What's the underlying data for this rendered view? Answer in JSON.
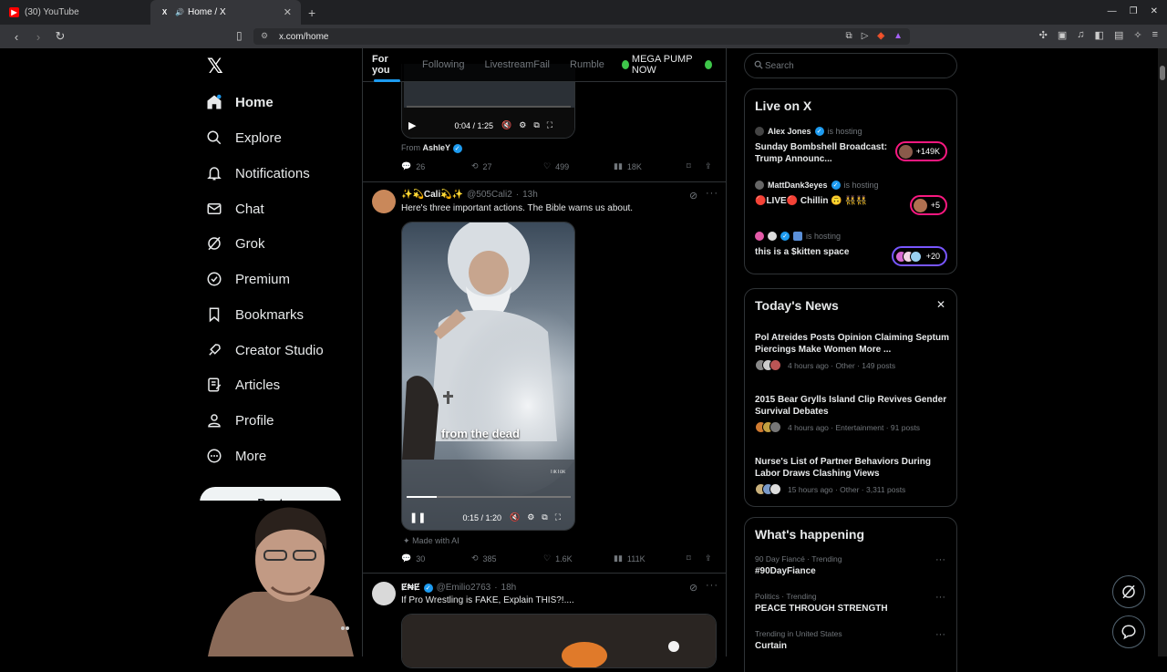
{
  "browser": {
    "tabs": [
      {
        "title": "(30) YouTube",
        "favicon_color": "#ff0000"
      },
      {
        "title": "Home / X",
        "favicon_color": "#ffffff"
      }
    ],
    "url": "x.com/home"
  },
  "nav": {
    "items": [
      {
        "label": "Home",
        "icon": "home-icon"
      },
      {
        "label": "Explore",
        "icon": "search-icon"
      },
      {
        "label": "Notifications",
        "icon": "bell-icon"
      },
      {
        "label": "Chat",
        "icon": "mail-icon"
      },
      {
        "label": "Grok",
        "icon": "grok-icon"
      },
      {
        "label": "Premium",
        "icon": "premium-icon"
      },
      {
        "label": "Bookmarks",
        "icon": "bookmark-icon"
      },
      {
        "label": "Creator Studio",
        "icon": "rocket-icon"
      },
      {
        "label": "Articles",
        "icon": "articles-icon"
      },
      {
        "label": "Profile",
        "icon": "person-icon"
      },
      {
        "label": "More",
        "icon": "more-icon"
      }
    ],
    "post_label": "Post"
  },
  "feed": {
    "tabs": [
      "For you",
      "Following",
      "LivestreamFail",
      "Rumble",
      "MEGA PUMP NOW"
    ],
    "tweet1": {
      "time": "0:04 / 1:25",
      "from_prefix": "From",
      "from_name": "AshleY",
      "replies": "26",
      "reposts": "27",
      "likes": "499",
      "views": "18K"
    },
    "tweet2": {
      "name": "✨💫Cali💫✨",
      "handle": "@505Cali2",
      "age": "13h",
      "text": "Here's three important actions. The Bible warns us about.",
      "caption": "from the dead",
      "watermark": "TikTok",
      "time": "0:15 / 1:20",
      "made_with_ai": "Made with AI",
      "replies": "30",
      "reposts": "385",
      "likes": "1.6K",
      "views": "111K"
    },
    "tweet3": {
      "name": "Ɇ₦Ɇ",
      "handle": "@Emilio2763",
      "age": "18h",
      "text": "If Pro Wrestling is FAKE, Explain THIS?!...."
    }
  },
  "sidebar": {
    "search_placeholder": "Search",
    "live": {
      "title": "Live on X",
      "items": [
        {
          "host": "Alex Jones",
          "suffix": "is hosting",
          "title": "Sunday Bombshell Broadcast: Trump Announc...",
          "count": "+149K"
        },
        {
          "host": "MattDank3eyes",
          "suffix": "is hosting",
          "title": "🔴LIVE🔴 Chillin 🙃 👯‍♀️👯",
          "count": "+5"
        },
        {
          "host": "",
          "suffix": "is hosting",
          "title": "this is a $kitten space",
          "count": "+20"
        }
      ]
    },
    "news": {
      "title": "Today's News",
      "items": [
        {
          "title": "Pol Atreides Posts Opinion Claiming Septum Piercings Make Women More ...",
          "meta": "4 hours ago · Other · 149 posts"
        },
        {
          "title": "2015 Bear Grylls Island Clip Revives Gender Survival Debates",
          "meta": "4 hours ago · Entertainment · 91 posts"
        },
        {
          "title": "Nurse's List of Partner Behaviors During Labor Draws Clashing Views",
          "meta": "15 hours ago · Other · 3,311 posts"
        }
      ]
    },
    "happening": {
      "title": "What's happening",
      "items": [
        {
          "meta": "90 Day Fiancé · Trending",
          "name": "#90DayFiance"
        },
        {
          "meta": "Politics · Trending",
          "name": "PEACE THROUGH STRENGTH"
        },
        {
          "meta": "Trending in United States",
          "name": "Curtain"
        }
      ]
    }
  }
}
